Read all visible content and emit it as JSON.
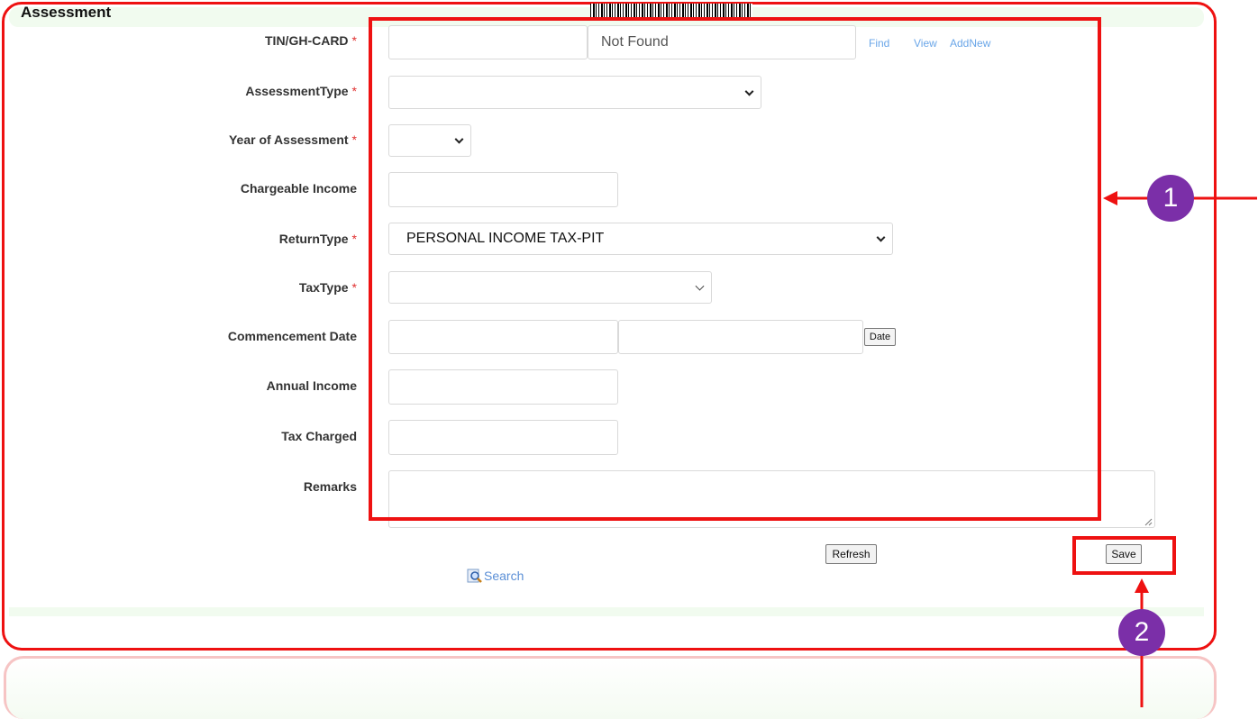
{
  "panel": {
    "title": "Assessment"
  },
  "form": {
    "tin": {
      "label": "TIN/GH-CARD",
      "required_mark": "*",
      "value": "",
      "lookup_value": "Not Found"
    },
    "links": {
      "find": "Find",
      "view": "View",
      "add_new": "AddNew"
    },
    "assessment_type": {
      "label": "AssessmentType",
      "required_mark": "*",
      "selected": ""
    },
    "year": {
      "label": "Year of Assessment",
      "required_mark": "*",
      "selected": ""
    },
    "chargeable_income": {
      "label": "Chargeable Income",
      "value": ""
    },
    "return_type": {
      "label": "ReturnType",
      "required_mark": "*",
      "selected": "PERSONAL INCOME TAX-PIT"
    },
    "tax_type": {
      "label": "TaxType",
      "required_mark": "*",
      "selected": ""
    },
    "commencement": {
      "label": "Commencement Date",
      "value": "",
      "value2": "",
      "date_button": "Date"
    },
    "annual_income": {
      "label": "Annual Income",
      "value": ""
    },
    "tax_charged": {
      "label": "Tax Charged",
      "value": ""
    },
    "remarks": {
      "label": "Remarks",
      "value": ""
    }
  },
  "actions": {
    "refresh": "Refresh",
    "save": "Save",
    "search": "Search"
  },
  "annotations": {
    "badge1": "1",
    "badge2": "2",
    "color": "#ee1111",
    "badge_color": "#7b2fa8"
  },
  "icons": [
    "chevron-down-icon",
    "search-icon",
    "arrow-left-icon",
    "arrow-up-icon",
    "barcode-icon"
  ]
}
